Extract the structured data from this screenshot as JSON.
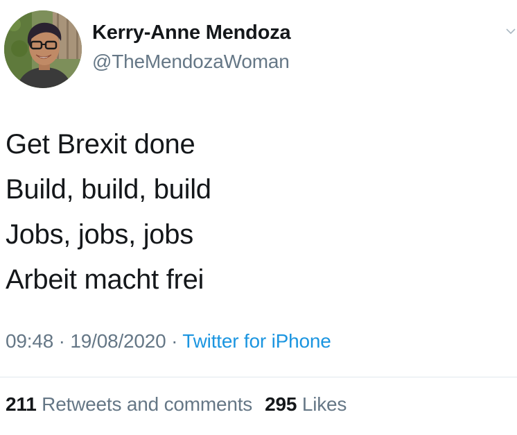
{
  "user": {
    "display_name": "Kerry-Anne Mendoza",
    "handle": "@TheMendozaWoman"
  },
  "tweet": {
    "lines": [
      "Get Brexit done",
      "Build, build, build",
      "Jobs, jobs, jobs",
      "Arbeit macht frei"
    ],
    "time": "09:48",
    "date": "19/08/2020",
    "separator": " · ",
    "source": "Twitter for iPhone"
  },
  "stats": {
    "retweets_count": "211",
    "retweets_label": "Retweets and comments",
    "likes_count": "295",
    "likes_label": "Likes"
  },
  "icons": {
    "menu": "chevron-down-icon",
    "avatar": "avatar"
  },
  "colors": {
    "text": "#14171a",
    "muted": "#657786",
    "link": "#1b95e0",
    "divider": "#e1e8ed"
  }
}
